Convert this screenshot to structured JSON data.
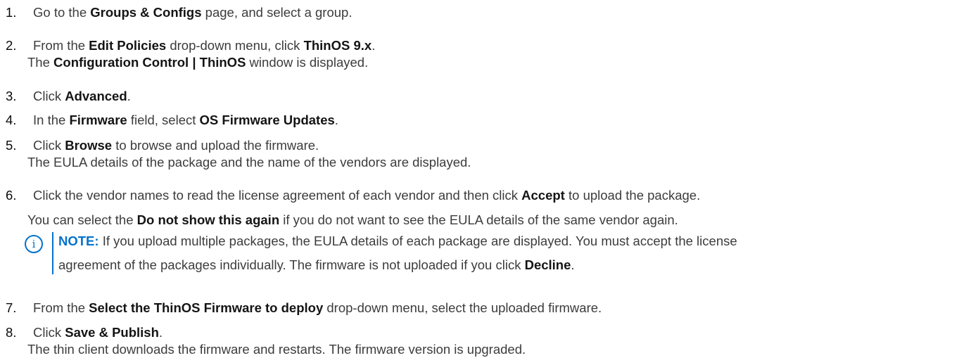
{
  "steps": [
    {
      "num": "1.",
      "pre": "Go to the ",
      "b1": "Groups & Configs",
      "post": " page, and select a group."
    },
    {
      "num": "2.",
      "pre": "From the ",
      "b1": "Edit Policies",
      "mid": " drop-down menu, click ",
      "b2": "ThinOS 9.x",
      "post": ".",
      "sub_pre": "The ",
      "sub_b": "Configuration Control | ThinOS",
      "sub_post": " window is displayed."
    },
    {
      "num": "3.",
      "pre": "Click ",
      "b1": "Advanced",
      "post": "."
    },
    {
      "num": "4.",
      "pre": "In the ",
      "b1": "Firmware",
      "mid": " field, select ",
      "b2": "OS Firmware Updates",
      "post": "."
    },
    {
      "num": "5.",
      "pre": "Click ",
      "b1": "Browse",
      "post": " to browse and upload the firmware.",
      "sub": "The EULA details of the package and the name of the vendors are displayed."
    },
    {
      "num": "6.",
      "pre": "Click the vendor names to read the license agreement of each vendor and then click ",
      "b1": "Accept",
      "post": " to upload the package.",
      "sub_pre": "You can select the ",
      "sub_b": "Do not show this again",
      "sub_post": " if you do not want to see the EULA details of the same vendor again."
    },
    {
      "num": "7.",
      "pre": "From the ",
      "b1": "Select the ThinOS Firmware to deploy",
      "post": " drop-down menu, select the uploaded firmware."
    },
    {
      "num": "8.",
      "pre": "Click ",
      "b1": "Save & Publish",
      "post": ".",
      "sub": "The thin client downloads the firmware and restarts. The firmware version is upgraded."
    }
  ],
  "note": {
    "label": "NOTE:",
    "line1": " If you upload multiple packages, the EULA details of each package are displayed. You must accept the license",
    "line2_pre": "agreement of the packages individually. The firmware is not uploaded if you click ",
    "line2_b": "Decline",
    "line2_post": ".",
    "icon": "info-icon",
    "accent": "#0672cb"
  }
}
